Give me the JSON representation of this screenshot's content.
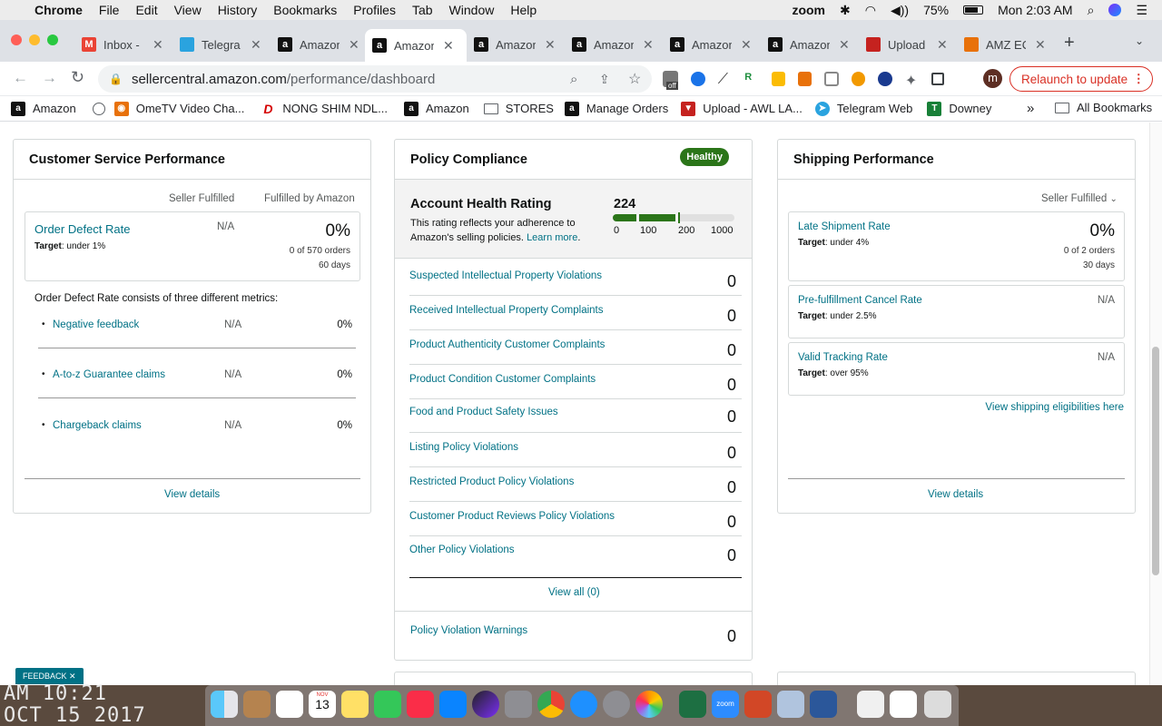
{
  "menubar": {
    "app": "Chrome",
    "items": [
      "File",
      "Edit",
      "View",
      "History",
      "Bookmarks",
      "Profiles",
      "Tab",
      "Window",
      "Help"
    ],
    "zoom_label": "zoom",
    "battery": "75%",
    "clock": "Mon 2:03 AM"
  },
  "tabs": [
    {
      "title": "Inbox - ",
      "icon": "gmail-icon",
      "color": "#ea4335"
    },
    {
      "title": "Telegra",
      "icon": "telegram-icon",
      "color": "#2aa3df"
    },
    {
      "title": "Amazon",
      "icon": "amazon-icon",
      "color": "#111"
    },
    {
      "title": "Amazon",
      "icon": "amazon-icon",
      "color": "#111",
      "active": true
    },
    {
      "title": "Amazon",
      "icon": "amazon-icon",
      "color": "#111"
    },
    {
      "title": "Amazon",
      "icon": "amazon-icon",
      "color": "#111"
    },
    {
      "title": "Amazon",
      "icon": "amazon-icon",
      "color": "#111"
    },
    {
      "title": "Amazon",
      "icon": "amazon-icon",
      "color": "#111"
    },
    {
      "title": "Upload",
      "icon": "upload-icon",
      "color": "#c5221f"
    },
    {
      "title": "AMZ EC",
      "icon": "amz-ec-icon",
      "color": "#e8710a"
    }
  ],
  "address": {
    "domain": "sellercentral.amazon.com",
    "path": "/performance/dashboard"
  },
  "relaunch_label": "Relaunch to update",
  "profile_initial": "m",
  "extension_badge": "off",
  "bookmarks": [
    {
      "label": "Amazon"
    },
    {
      "label": ""
    },
    {
      "label": "OmeTV Video Cha..."
    },
    {
      "label": "NONG SHIM NDL..."
    },
    {
      "label": "Amazon"
    },
    {
      "label": "STORES"
    },
    {
      "label": "Manage Orders"
    },
    {
      "label": "Upload - AWL LA..."
    },
    {
      "label": "Telegram Web"
    },
    {
      "label": "Downey"
    }
  ],
  "bookmarks_more": "»",
  "all_bookmarks": "All Bookmarks",
  "customer_service": {
    "title": "Customer Service Performance",
    "col_seller": "Seller Fulfilled",
    "col_fba": "Fulfilled by Amazon",
    "odr_label": "Order Defect Rate",
    "odr_target_prefix": "Target",
    "odr_target": ": under 1%",
    "odr_seller": "N/A",
    "odr_fba": "0%",
    "odr_orders": "0 of 570 orders",
    "odr_days": "60 days",
    "consists": "Order Defect Rate consists of three different metrics:",
    "metrics": [
      {
        "label": "Negative feedback",
        "seller": "N/A",
        "fba": "0%"
      },
      {
        "label": "A-to-z Guarantee claims",
        "seller": "N/A",
        "fba": "0%"
      },
      {
        "label": "Chargeback claims",
        "seller": "N/A",
        "fba": "0%"
      }
    ],
    "view_details": "View details"
  },
  "policy": {
    "title": "Policy Compliance",
    "badge": "Healthy",
    "ahr_title": "Account Health Rating",
    "ahr_desc": "This rating reflects your adherence to Amazon's selling policies.",
    "learn_more": "Learn more",
    "ahr_value": "224",
    "ahr_score": 224,
    "scale": [
      "0",
      "100",
      "200",
      "1000"
    ],
    "rows": [
      {
        "label": "Suspected Intellectual Property Violations",
        "value": "0"
      },
      {
        "label": "Received Intellectual Property Complaints",
        "value": "0"
      },
      {
        "label": "Product Authenticity Customer Complaints",
        "value": "0"
      },
      {
        "label": "Product Condition Customer Complaints",
        "value": "0"
      },
      {
        "label": "Food and Product Safety Issues",
        "value": "0"
      },
      {
        "label": "Listing Policy Violations",
        "value": "0"
      },
      {
        "label": "Restricted Product Policy Violations",
        "value": "0"
      },
      {
        "label": "Customer Product Reviews Policy Violations",
        "value": "0"
      },
      {
        "label": "Other Policy Violations",
        "value": "0"
      }
    ],
    "view_all": "View all (0)",
    "warnings_label": "Policy Violation Warnings",
    "warnings_value": "0"
  },
  "shipping": {
    "title": "Shipping Performance",
    "filter": "Seller Fulfilled",
    "late_label": "Late Shipment Rate",
    "late_target": ": under 4%",
    "late_value": "0%",
    "late_orders": "0 of 2 orders",
    "late_days": "30 days",
    "cancel_label": "Pre-fulfillment Cancel Rate",
    "cancel_target": ": under 2.5%",
    "cancel_value": "N/A",
    "tracking_label": "Valid Tracking Rate",
    "tracking_target": ": over 95%",
    "tracking_value": "N/A",
    "eligibilities": "View shipping eligibilities here",
    "view_details": "View details"
  },
  "target_word": "Target",
  "feedback": "FEEDBACK",
  "desktop_clock_line1": "AM 10:21",
  "desktop_clock_line2": "OCT 15 2017",
  "calendar_month": "NOV",
  "calendar_day": "13",
  "zoom_dock_label": "zoom",
  "colors": {
    "link": "#007185",
    "healthy": "#2b7519",
    "relaunch": "#d93025"
  }
}
